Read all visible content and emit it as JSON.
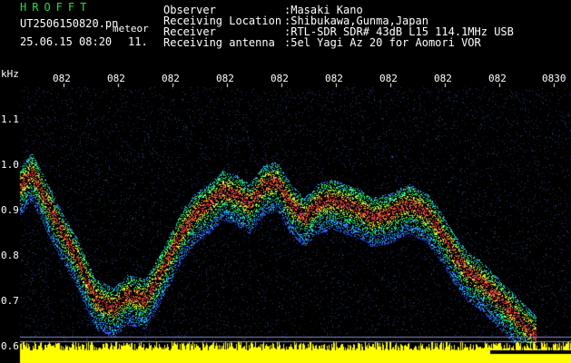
{
  "header": {
    "program": "HROFFT",
    "filename": "UT2506150820.pn",
    "tag": "meteor",
    "date_time": "25.06.15 08:20",
    "count": "11.",
    "fields": [
      {
        "label": "Observer",
        "value": ":Masaki Kano"
      },
      {
        "label": "Receiving Location",
        "value": ":Shibukawa,Gunma,Japan"
      },
      {
        "label": "Receiver",
        "value": ":RTL-SDR SDR# 43dB L15 114.1MHz USB"
      },
      {
        "label": "Receiving antenna",
        "value": ":5el Yagi Az 20 for Aomori VOR"
      }
    ]
  },
  "axis": {
    "unit": "kHz",
    "y_labels": [
      "1.1",
      "1.0",
      "0.9",
      "0.8",
      "0.7",
      "0.6"
    ],
    "x_labels": [
      "082",
      "082",
      "082",
      "082",
      "082",
      "082",
      "082",
      "082",
      "082",
      "0830"
    ]
  },
  "colors": {
    "background": "#000000",
    "text": "#ffffff",
    "title": "#22dd44",
    "noise_band": "#ffff00",
    "reference_lines": "#8888cc"
  }
}
